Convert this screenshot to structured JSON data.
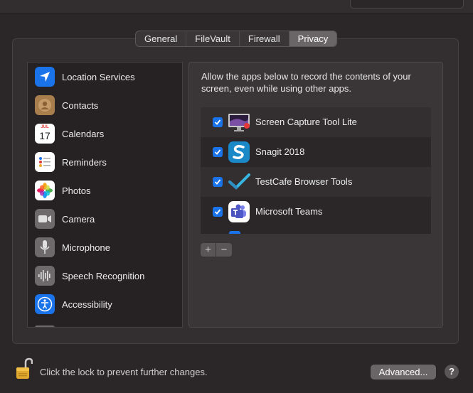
{
  "tabs": [
    {
      "label": "General",
      "active": false
    },
    {
      "label": "FileVault",
      "active": false
    },
    {
      "label": "Firewall",
      "active": false
    },
    {
      "label": "Privacy",
      "active": true
    }
  ],
  "sidebar": {
    "items": [
      {
        "label": "Location Services",
        "icon": "location-arrow-icon",
        "color": "#1a73e8"
      },
      {
        "label": "Contacts",
        "icon": "contacts-icon",
        "color": "#a87e4d"
      },
      {
        "label": "Calendars",
        "icon": "calendar-icon",
        "color": "#ffffff",
        "cal_month": "JUL",
        "cal_day": "17"
      },
      {
        "label": "Reminders",
        "icon": "reminders-icon",
        "color": "#ffffff"
      },
      {
        "label": "Photos",
        "icon": "photos-icon",
        "color": "#ffffff"
      },
      {
        "label": "Camera",
        "icon": "camera-icon",
        "color": "#6e6a6c"
      },
      {
        "label": "Microphone",
        "icon": "microphone-icon",
        "color": "#6e6a6c"
      },
      {
        "label": "Speech Recognition",
        "icon": "speech-waveform-icon",
        "color": "#6e6a6c"
      },
      {
        "label": "Accessibility",
        "icon": "accessibility-icon",
        "color": "#1a73e8"
      }
    ]
  },
  "privacy": {
    "description": "Allow the apps below to record the contents of your screen, even while using other apps.",
    "apps": [
      {
        "name": "Screen Capture Tool Lite",
        "checked": true,
        "icon": "screen-capture-icon"
      },
      {
        "name": "Snagit 2018",
        "checked": true,
        "icon": "snagit-icon"
      },
      {
        "name": "TestCafe Browser Tools",
        "checked": true,
        "icon": "testcafe-icon"
      },
      {
        "name": "Microsoft Teams",
        "checked": true,
        "icon": "teams-icon"
      }
    ],
    "add_label": "+",
    "remove_label": "−"
  },
  "footer": {
    "lock_text": "Click the lock to prevent further changes.",
    "advanced_label": "Advanced...",
    "help_label": "?"
  },
  "colors": {
    "accent": "#1a73e8",
    "background": "#2b2628"
  }
}
